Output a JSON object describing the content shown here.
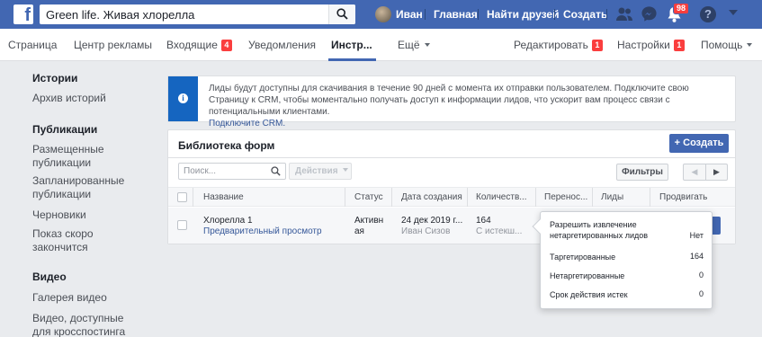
{
  "topbar": {
    "logo": "f",
    "search_value": "Green life. Живая хлорелла",
    "user_name": "Иван",
    "home": "Главная",
    "find_friends": "Найти друзей",
    "create": "Создать",
    "notifications_count": "98",
    "help": "?"
  },
  "nav": {
    "page": "Страница",
    "ad_center": "Центр рекламы",
    "inbox": "Входящие",
    "inbox_count": "4",
    "notifications": "Уведомления",
    "tools": "Инстр...",
    "more": "Ещё",
    "edit": "Редактировать",
    "edit_count": "1",
    "settings": "Настройки",
    "settings_count": "1",
    "help": "Помощь"
  },
  "sidebar": {
    "stories_head": "Истории",
    "stories_archive": "Архив историй",
    "publications_head": "Публикации",
    "published": "Размещенные публикации",
    "scheduled": "Запланированные публикации",
    "drafts": "Черновики",
    "expiring": "Показ скоро закончится",
    "video_head": "Видео",
    "video_gallery": "Галерея видео",
    "crossposting": "Видео, доступные для кросспостинга"
  },
  "banner": {
    "text": "Лиды будут доступны для скачивания в течение 90 дней с момента их отправки пользователем. Подключите свою Страницу к CRM, чтобы моментально получать доступ к информации лидов, что ускорит вам процесс связи с потенциальными клиентами.",
    "link": "Подключите CRM."
  },
  "library": {
    "title": "Библиотека форм",
    "create_button": "+ Создать",
    "search_placeholder": "Поиск...",
    "actions": "Действия",
    "filters": "Фильтры",
    "pager_prev": "◀",
    "pager_next": "▶",
    "columns": [
      "Название",
      "Статус",
      "Дата создания",
      "Количеств...",
      "Перенос...",
      "Лиды",
      "Продвигать"
    ],
    "row": {
      "name": "Хлорелла 1",
      "preview": "Предварительный просмотр",
      "status_line1": "Активн",
      "status_line2": "ая",
      "date": "24 дек 2019 г...",
      "author": "Иван Сизов",
      "count": "164",
      "count_sub": "С истекш..."
    }
  },
  "popover": {
    "items": [
      {
        "label": "Разрешить извлечение нетаргетированных лидов",
        "value": "Нет"
      },
      {
        "label": "Таргетированные",
        "value": "164"
      },
      {
        "label": "Нетаргетированные",
        "value": "0"
      },
      {
        "label": "Срок действия истек",
        "value": "0"
      }
    ]
  }
}
